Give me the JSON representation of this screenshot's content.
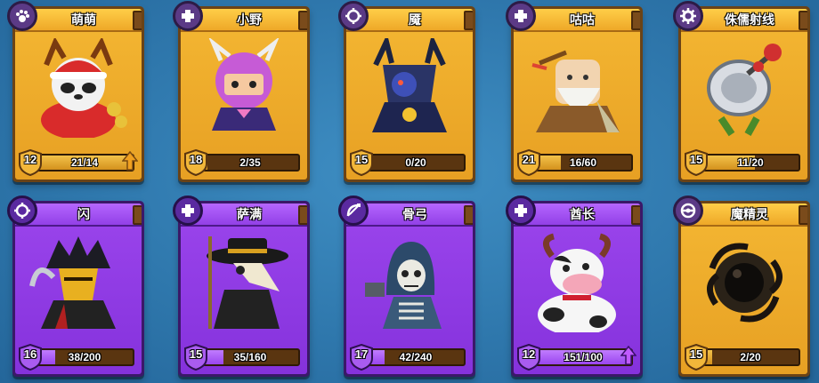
{
  "cards": [
    {
      "name": "萌萌",
      "level": "12",
      "progress_text": "21/14",
      "progress": 1.0,
      "rarity": "gold",
      "role_icon": "paw-icon",
      "upgradable": true,
      "portrait": "santa-panda-icon"
    },
    {
      "name": "小野",
      "level": "18",
      "progress_text": "2/35",
      "progress": 0.06,
      "rarity": "gold",
      "role_icon": "gamepad-cross-icon",
      "upgradable": false,
      "portrait": "horned-helmet-girl-icon"
    },
    {
      "name": "魇",
      "level": "15",
      "progress_text": "0/20",
      "progress": 0.0,
      "rarity": "gold",
      "role_icon": "target-icon",
      "upgradable": false,
      "portrait": "dark-knight-icon"
    },
    {
      "name": "咕咕",
      "level": "21",
      "progress_text": "16/60",
      "progress": 0.27,
      "rarity": "gold",
      "role_icon": "gamepad-cross-icon",
      "upgradable": false,
      "portrait": "old-sage-icon"
    },
    {
      "name": "侏儒射线",
      "level": "15",
      "progress_text": "11/20",
      "progress": 0.55,
      "rarity": "gold",
      "role_icon": "gear-icon",
      "upgradable": false,
      "portrait": "ray-dish-icon"
    },
    {
      "name": "闪",
      "level": "16",
      "progress_text": "38/200",
      "progress": 0.19,
      "rarity": "purple",
      "role_icon": "target-icon",
      "upgradable": false,
      "portrait": "masked-ninja-icon"
    },
    {
      "name": "萨满",
      "level": "15",
      "progress_text": "35/160",
      "progress": 0.22,
      "rarity": "purple",
      "role_icon": "gamepad-cross-icon",
      "upgradable": false,
      "portrait": "plague-doctor-icon"
    },
    {
      "name": "骨弓",
      "level": "17",
      "progress_text": "42/240",
      "progress": 0.18,
      "rarity": "purple",
      "role_icon": "bow-icon",
      "upgradable": false,
      "portrait": "skeleton-archer-icon"
    },
    {
      "name": "酋长",
      "level": "12",
      "progress_text": "151/100",
      "progress": 1.0,
      "rarity": "purple",
      "role_icon": "gamepad-cross-icon",
      "upgradable": true,
      "portrait": "cow-chief-icon"
    },
    {
      "name": "魔精灵",
      "level": "15",
      "progress_text": "2/20",
      "progress": 0.1,
      "rarity": "gold",
      "role_icon": "pokeball-icon",
      "upgradable": false,
      "portrait": "dark-orb-icon"
    }
  ],
  "colors": {
    "gold": "#f4b733",
    "purple": "#9b45ec",
    "background": "#2f78ad",
    "upgrade_gold": "#f0a020",
    "upgrade_purple": "#c05aff"
  }
}
